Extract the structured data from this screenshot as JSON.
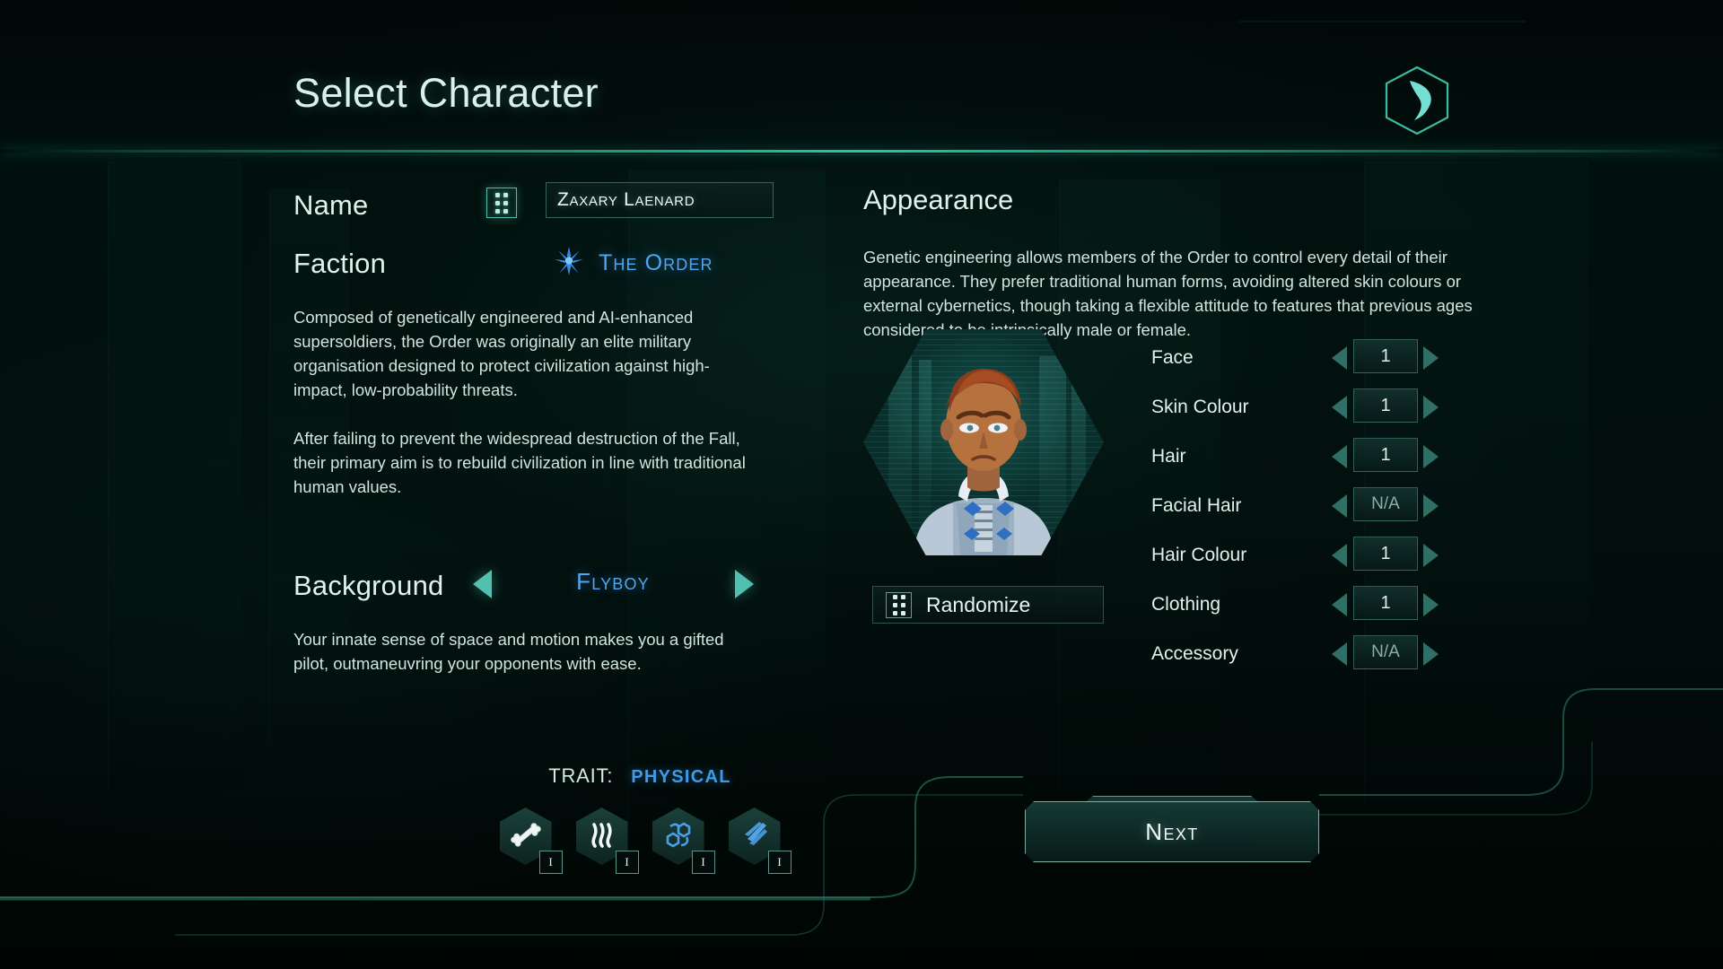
{
  "header": {
    "title": "Select Character",
    "logo_icon": "hexagon-hook-logo"
  },
  "name_section": {
    "label": "Name",
    "randomize_icon": "dice-icon",
    "value": "Zaxary Laenard",
    "placeholder": "Zaxary Laenard"
  },
  "faction_section": {
    "label": "Faction",
    "icon": "starburst-icon",
    "value": "The Order",
    "paragraphs": [
      "Composed of genetically engineered and AI-enhanced supersoldiers, the Order was originally an elite military organisation designed to protect civilization against high-impact, low-probability threats.",
      "After failing to prevent the widespread destruction of the Fall, their primary aim is to rebuild civilization in line with traditional human values."
    ]
  },
  "background_section": {
    "label": "Background",
    "prev_icon": "triangle-left-icon",
    "next_icon": "triangle-right-icon",
    "value": "Flyboy",
    "description": "Your innate sense of space and motion makes you a gifted pilot, outmaneuvring your opponents with ease."
  },
  "trait_section": {
    "key": "TRAIT:",
    "value": "PHYSICAL",
    "skills": [
      {
        "icon": "bone-icon",
        "level": "I"
      },
      {
        "icon": "flame-wisp-icon",
        "level": "I"
      },
      {
        "icon": "molecule-icon",
        "level": "I"
      },
      {
        "icon": "speed-stripes-icon",
        "level": "I"
      }
    ]
  },
  "appearance_section": {
    "title": "Appearance",
    "description": "Genetic engineering allows members of the Order to control every detail of their appearance. They prefer traditional human forms, avoiding altered skin colours or external cybernetics, though taking a flexible attitude to features that previous ages considered to be intrinsically male or female.",
    "portrait_icon": "character-portrait",
    "randomize": {
      "icon": "dice-icon",
      "label": "Randomize"
    },
    "options": [
      {
        "label": "Face",
        "value": "1"
      },
      {
        "label": "Skin Colour",
        "value": "1"
      },
      {
        "label": "Hair",
        "value": "1"
      },
      {
        "label": "Facial Hair",
        "value": "N/A"
      },
      {
        "label": "Hair Colour",
        "value": "1"
      },
      {
        "label": "Clothing",
        "value": "1"
      },
      {
        "label": "Accessory",
        "value": "N/A"
      }
    ]
  },
  "footer": {
    "next_label": "Next"
  },
  "colors": {
    "background": "#010807",
    "accent_teal": "#2ad0aa",
    "accent_blue": "#4fa8ef",
    "text_primary": "#dff4ec",
    "text_body": "#cfe6dd",
    "divider": "#28c8a5"
  }
}
